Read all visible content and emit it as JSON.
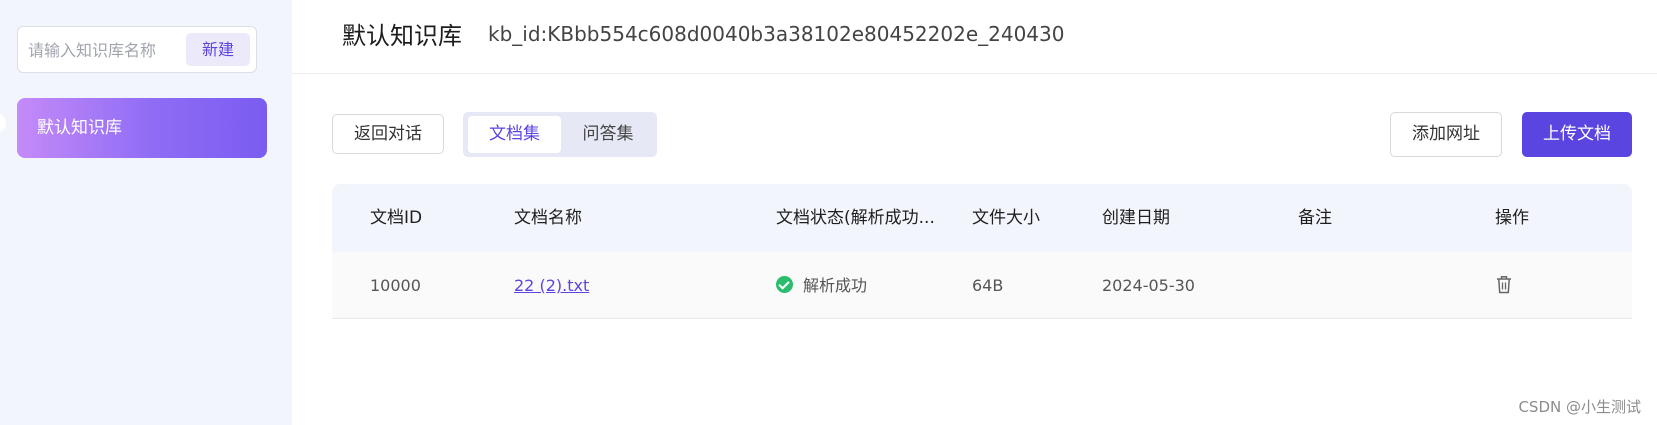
{
  "sidebar": {
    "search_placeholder": "请输入知识库名称",
    "new_label": "新建",
    "kb_items": [
      {
        "label": "默认知识库",
        "active": true
      }
    ]
  },
  "header": {
    "title": "默认知识库",
    "kb_id": "kb_id:KBbb554c608d0040b3a38102e80452202e_240430"
  },
  "toolbar": {
    "back_label": "返回对话",
    "tabs": [
      {
        "label": "文档集",
        "active": true
      },
      {
        "label": "问答集",
        "active": false
      }
    ],
    "add_url_label": "添加网址",
    "upload_label": "上传文档"
  },
  "table": {
    "columns": [
      "文档ID",
      "文档名称",
      "文档状态(解析成功...",
      "文件大小",
      "创建日期",
      "备注",
      "操作"
    ],
    "rows": [
      {
        "id": "10000",
        "name": "22 (2).txt",
        "status": "解析成功",
        "size": "64B",
        "date": "2024-05-30",
        "note": "",
        "action_icon": "trash-icon"
      }
    ]
  },
  "watermark": "CSDN @小生测试",
  "colors": {
    "accent": "#5b45e0",
    "sidebar_bg": "#f3f5fc",
    "success": "#2bbd6e",
    "gradient_start": "#c58af8",
    "gradient_end": "#7a5cf0"
  }
}
